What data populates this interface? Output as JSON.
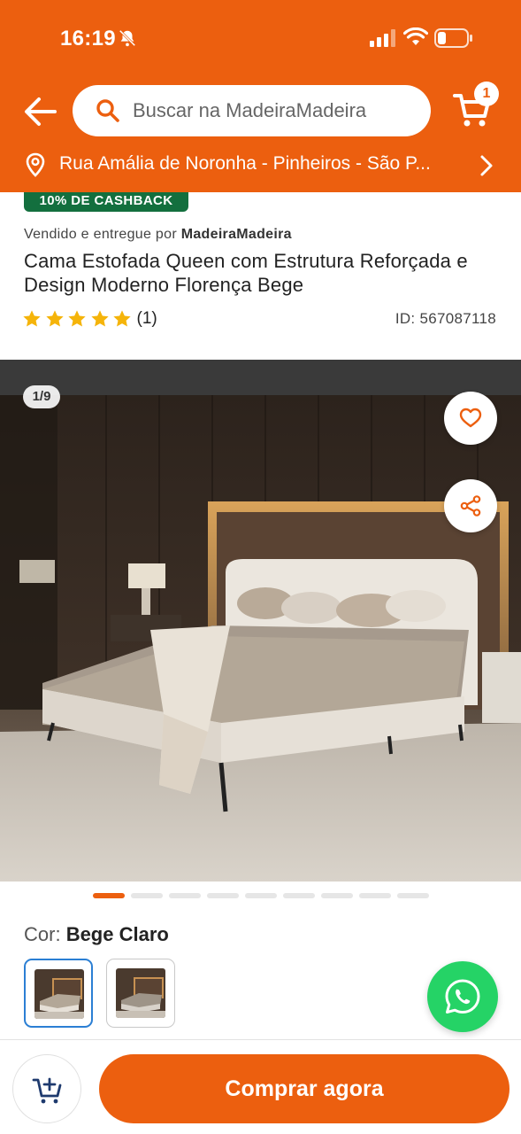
{
  "status_bar": {
    "time": "16:19"
  },
  "header": {
    "search": {
      "placeholder": "Buscar na MadeiraMadeira"
    },
    "cart_count": "1",
    "location": "Rua Amália de Noronha - Pinheiros - São P..."
  },
  "product": {
    "badge": "10% DE CASHBACK",
    "seller_prefix": "Vendido e entregue por",
    "seller_name": "MadeiraMadeira",
    "title": "Cama Estofada Queen com Estrutura Reforçada e Design Moderno Florença Bege",
    "rating_stars": 5,
    "rating_count": "(1)",
    "id": "ID: 567087118"
  },
  "gallery": {
    "counter": "1/9",
    "current_index": 1,
    "total": 9
  },
  "color": {
    "label": "Cor:",
    "selected": "Bege Claro",
    "options_count": 2
  },
  "actions": {
    "buy_label": "Comprar agora"
  },
  "colors": {
    "brand": "#ec5f0f",
    "cashback_green": "#136f3e",
    "star": "#f5b40a",
    "whatsapp": "#25d366",
    "selected_border": "#2b7fd4"
  },
  "icons": {
    "back": "arrow-left-icon",
    "search": "search-icon",
    "cart": "cart-icon",
    "location": "location-pin-icon",
    "chevron": "chevron-right-icon",
    "favorite": "heart-icon",
    "share": "share-icon",
    "whatsapp": "whatsapp-icon",
    "add_to_cart": "cart-plus-icon"
  }
}
